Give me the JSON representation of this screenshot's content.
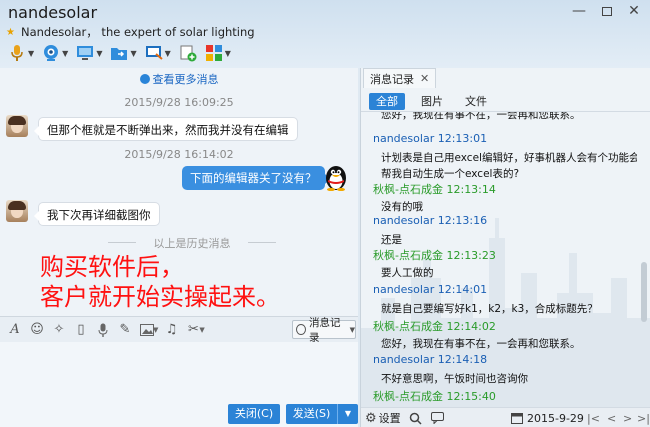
{
  "window": {
    "title": "nandesolar",
    "signature": "Nandesolar， the expert of solar lighting",
    "controls": {
      "minimize": "—",
      "close": "✕"
    }
  },
  "toolbar": {
    "icons": [
      "microphone-icon",
      "webcam-icon",
      "screen-share-icon",
      "folder-send-icon",
      "remote-desktop-icon",
      "add-contact-icon",
      "apps-grid-icon"
    ]
  },
  "chat": {
    "more_messages": "查看更多消息",
    "timestamp1": "2015/9/28 16:09:25",
    "msg1": "但那个框就是不断弹出来，然而我并没有在编辑",
    "timestamp2": "2015/9/28 16:14:02",
    "msg2": "下面的编辑器关了没有？",
    "msg3": "我下次再详细截图你",
    "history_divider": "以上是历史消息",
    "overlay_line1": "购买软件后，",
    "overlay_line2": "客户就开始实操起来。"
  },
  "input": {
    "history_button": "消息记录",
    "close_button": "关闭(C)",
    "send_button": "发送(S)"
  },
  "history_panel": {
    "tab": "消息记录",
    "filters": [
      "全部",
      "图片",
      "文件"
    ],
    "messages": [
      {
        "text": "您好，我现在有事不在，一会再和您联系。"
      },
      {
        "sender": "nandesolar",
        "time": "12:13:01",
        "text": "计划表是自己用excel编辑好，好事机器人会有个功能会"
      },
      {
        "text": "帮我自动生成一个excel表的?"
      },
      {
        "sender": "秋枫-点石成金",
        "time": "12:13:14",
        "text": "没有的哦"
      },
      {
        "sender": "nandesolar",
        "time": "12:13:16",
        "text": "还是"
      },
      {
        "sender": "秋枫-点石成金",
        "time": "12:13:23",
        "text": "要人工做的"
      },
      {
        "sender": "nandesolar",
        "time": "12:14:01",
        "text": "就是自己要编写好k1，k2，k3，合成标题先？"
      },
      {
        "sender": "秋枫-点石成金",
        "time": "12:14:02",
        "text": "您好，我现在有事不在，一会再和您联系。"
      },
      {
        "sender": "nandesolar",
        "time": "12:14:18",
        "text": "不好意思啊，午饭时间也咨询你"
      },
      {
        "sender": "秋枫-点石成金",
        "time": "12:15:40",
        "text": ""
      }
    ],
    "footer": {
      "settings": "设置",
      "date": "2015-9-29"
    }
  },
  "colors": {
    "accent": "#2b83d6",
    "sender_self": "#1a5fb4",
    "sender_other": "#2a9b2a",
    "overlay": "#ff1111"
  }
}
